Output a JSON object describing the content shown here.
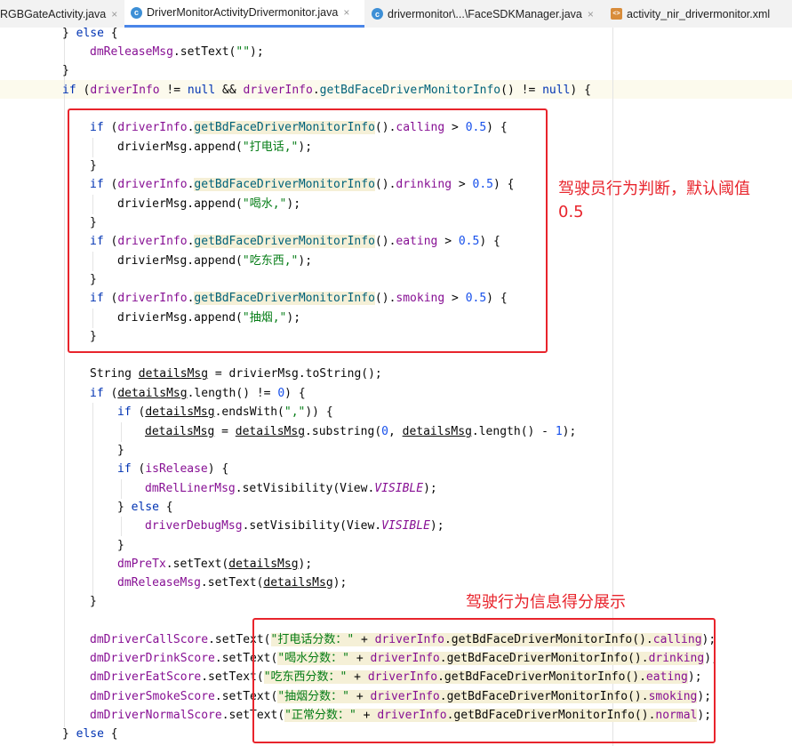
{
  "tabs": [
    {
      "label": "RGBGateActivity.java",
      "icon": "class-icon",
      "active": false
    },
    {
      "label": "DriverMonitorActivityDrivermonitor.java",
      "icon": "class-icon",
      "active": true
    },
    {
      "label": "drivermonitor\\...\\FaceSDKManager.java",
      "icon": "class-icon",
      "active": false
    },
    {
      "label": "activity_nir_drivermonitor.xml",
      "icon": "xml-icon",
      "active": false
    }
  ],
  "tab_icon_glyph": "c",
  "tab_close_glyph": "×",
  "code": {
    "l01": {
      "a": "} ",
      "b": "else",
      "c": " {"
    },
    "l02": {
      "a": "dmReleaseMsg",
      "b": ".setText(",
      "c": "\"\"",
      "d": ");"
    },
    "l03": {
      "a": "}"
    },
    "l04": {
      "a": "if",
      "b": " (",
      "c": "driverInfo",
      "d": " != ",
      "e": "null",
      "f": " && ",
      "g": "driverInfo",
      "h": ".",
      "i": "getBdFaceDriverMonitorInfo",
      "j": "() != ",
      "k": "null",
      "l": ") {"
    },
    "l05": {
      "a": "if",
      "b": " (",
      "c": "driverInfo",
      "d": ".",
      "e": "getBdFaceDriverMonitorInfo",
      "f": "().",
      "g": "calling",
      "h": " > ",
      "i": "0.5",
      "j": ") {"
    },
    "l06": {
      "a": "drivierMsg.append(",
      "b": "\"打电话,\"",
      "c": ");"
    },
    "l07": {
      "a": "}"
    },
    "l08": {
      "a": "if",
      "b": " (",
      "c": "driverInfo",
      "d": ".",
      "e": "getBdFaceDriverMonitorInfo",
      "f": "().",
      "g": "drinking",
      "h": " > ",
      "i": "0.5",
      "j": ") {"
    },
    "l09": {
      "a": "drivierMsg.append(",
      "b": "\"喝水,\"",
      "c": ");"
    },
    "l10": {
      "a": "}"
    },
    "l11": {
      "a": "if",
      "b": " (",
      "c": "driverInfo",
      "d": ".",
      "e": "getBdFaceDriverMonitorInfo",
      "f": "().",
      "g": "eating",
      "h": " > ",
      "i": "0.5",
      "j": ") {"
    },
    "l12": {
      "a": "drivierMsg.append(",
      "b": "\"吃东西,\"",
      "c": ");"
    },
    "l13": {
      "a": "}"
    },
    "l14": {
      "a": "if",
      "b": " (",
      "c": "driverInfo",
      "d": ".",
      "e": "getBdFaceDriverMonitorInfo",
      "f": "().",
      "g": "smoking",
      "h": " > ",
      "i": "0.5",
      "j": ") {"
    },
    "l15": {
      "a": "drivierMsg.append(",
      "b": "\"抽烟,\"",
      "c": ");"
    },
    "l16": {
      "a": "}"
    },
    "l17": {
      "a": "String ",
      "b": "detailsMsg",
      "c": " = drivierMsg.toString();"
    },
    "l18": {
      "a": "if",
      "b": " (",
      "c": "detailsMsg",
      "d": ".length() != ",
      "e": "0",
      "f": ") {"
    },
    "l19": {
      "a": "if",
      "b": " (",
      "c": "detailsMsg",
      "d": ".endsWith(",
      "e": "\",\"",
      "f": ")) {"
    },
    "l20": {
      "a": "detailsMsg",
      "b": " = ",
      "c": "detailsMsg",
      "d": ".substring(",
      "e": "0",
      "f": ", ",
      "g": "detailsMsg",
      "h": ".length() - ",
      "i": "1",
      "j": ");"
    },
    "l21": {
      "a": "}"
    },
    "l22": {
      "a": "if",
      "b": " (",
      "c": "isRelease",
      "d": ") {"
    },
    "l23": {
      "a": "dmRelLinerMsg",
      "b": ".setVisibility(View.",
      "c": "VISIBLE",
      "d": ");"
    },
    "l24": {
      "a": "} ",
      "b": "else",
      "c": " {"
    },
    "l25": {
      "a": "driverDebugMsg",
      "b": ".setVisibility(View.",
      "c": "VISIBLE",
      "d": ");"
    },
    "l26": {
      "a": "}"
    },
    "l27": {
      "a": "dmPreTx",
      "b": ".setText(",
      "c": "detailsMsg",
      "d": ");"
    },
    "l28": {
      "a": "dmReleaseMsg",
      "b": ".setText(",
      "c": "detailsMsg",
      "d": ");"
    },
    "l29": {
      "a": "}"
    },
    "l30": {
      "a": "dmDriverCallScore",
      "b": ".setText(",
      "c": "\"打电话分数：\"",
      "d": " + ",
      "e": "driverInfo",
      "f": ".getBdFaceDriverMonitorInfo().",
      "g": "calling",
      "h": ");"
    },
    "l31": {
      "a": "dmDriverDrinkScore",
      "b": ".setText(",
      "c": "\"喝水分数：\"",
      "d": " + ",
      "e": "driverInfo",
      "f": ".getBdFaceDriverMonitorInfo().",
      "g": "drinking",
      "h": ");"
    },
    "l32": {
      "a": "dmDriverEatScore",
      "b": ".setText(",
      "c": "\"吃东西分数：\"",
      "d": " + ",
      "e": "driverInfo",
      "f": ".getBdFaceDriverMonitorInfo().",
      "g": "eating",
      "h": ");"
    },
    "l33": {
      "a": "dmDriverSmokeScore",
      "b": ".setText(",
      "c": "\"抽烟分数：\"",
      "d": " + ",
      "e": "driverInfo",
      "f": ".getBdFaceDriverMonitorInfo().",
      "g": "smoking",
      "h": ");"
    },
    "l34": {
      "a": "dmDriverNormalScore",
      "b": ".setText(",
      "c": "\"正常分数：\"",
      "d": " + ",
      "e": "driverInfo",
      "f": ".getBdFaceDriverMonitorInfo().",
      "g": "normal",
      "h": ");"
    },
    "l35": {
      "a": "} ",
      "b": "else",
      "c": " {"
    }
  },
  "annotations": {
    "behavior_judgement_line1": "驾驶员行为判断，默认阈值",
    "behavior_judgement_line2": "0.5",
    "score_display": "驾驶行为信息得分展示"
  },
  "colors": {
    "annotation": "#e8242c",
    "keyword": "#0033b3",
    "field": "#871094",
    "string": "#067d17",
    "number": "#1750eb",
    "method": "#00627a",
    "active_tab_underline": "#4a86e8"
  }
}
